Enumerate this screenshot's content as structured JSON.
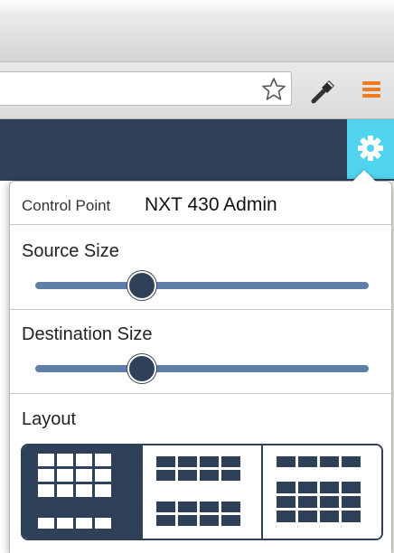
{
  "browser": {
    "toolbar_icons": [
      "star-icon",
      "wrench-icon",
      "menu-icon"
    ],
    "menu_icon_color": "#f07b1e"
  },
  "header": {
    "background": "#2f4159",
    "gear_button_color": "#4fd3ef"
  },
  "popup": {
    "title_small": "Control Point",
    "title_big": "NXT 430 Admin",
    "source_size": {
      "label": "Source Size",
      "value": 0.32
    },
    "destination_size": {
      "label": "Destination Size",
      "value": 0.32
    },
    "layout": {
      "label": "Layout",
      "options": [
        {
          "name": "layout-grid-4x4",
          "selected": true
        },
        {
          "name": "layout-grid-4x2-split",
          "selected": false
        },
        {
          "name": "layout-grid-4x4-alt",
          "selected": false
        }
      ]
    }
  }
}
